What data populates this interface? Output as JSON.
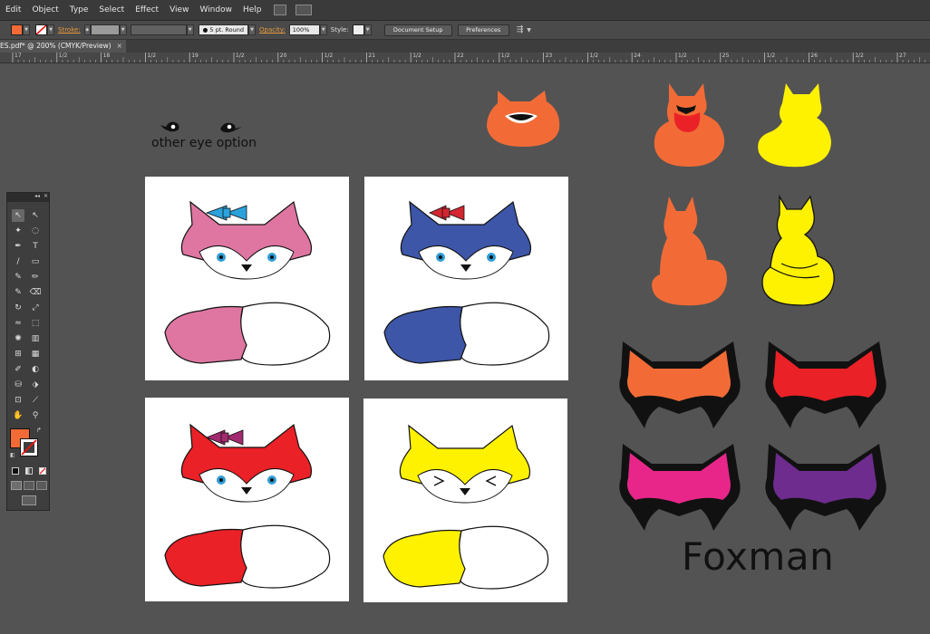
{
  "menu": [
    "Edit",
    "Object",
    "Type",
    "Select",
    "Effect",
    "View",
    "Window",
    "Help"
  ],
  "control_bar": {
    "stroke_label": "Stroke:",
    "brush": "5 pt. Round",
    "opacity_label": "Opacity:",
    "opacity_value": "100%",
    "style_label": "Style:",
    "document_setup": "Document Setup",
    "preferences": "Preferences",
    "fill_color": "#f26b36"
  },
  "document_tab": {
    "title": "ES.pdf* @ 200% (CMYK/Preview)",
    "close": "×"
  },
  "ruler": {
    "labels": [
      "17",
      "1/2",
      "18",
      "1/2",
      "19",
      "1/2",
      "20",
      "1/2",
      "21",
      "1/2",
      "22",
      "1/2",
      "23",
      "1/2",
      "24",
      "1/2",
      "25",
      "1/2",
      "26",
      "1/2",
      "27"
    ]
  },
  "canvas": {
    "eye_option_label": "other eye option",
    "foxman_label": "Foxman",
    "fox_variants": [
      {
        "fur": "#de76a1",
        "bow": "#2ba2dc"
      },
      {
        "fur": "#3d56a8",
        "bow": "#d32630"
      },
      {
        "fur": "#ea2127",
        "bow": "#a22a6e"
      },
      {
        "fur": "#fff200",
        "bow": ""
      }
    ],
    "mask_colors": [
      "#f26b36",
      "#ea2127",
      "#e8268a",
      "#6d2c8e"
    ],
    "icon_colors": {
      "orange": "#f26b36",
      "yellow": "#fff200",
      "red": "#ea2127"
    }
  },
  "toolbox": {
    "fill_color": "#f26b36",
    "tools": [
      "selection-tool",
      "direct-selection-tool",
      "magic-wand-tool",
      "lasso-tool",
      "pen-tool",
      "type-tool",
      "line-tool",
      "rectangle-tool",
      "paintbrush-tool",
      "pencil-tool",
      "blob-brush-tool",
      "eraser-tool",
      "rotate-tool",
      "scale-tool",
      "warp-tool",
      "free-transform-tool",
      "symbol-sprayer-tool",
      "column-graph-tool",
      "mesh-tool",
      "gradient-tool",
      "eyedropper-tool",
      "blend-tool",
      "live-paint-bucket-tool",
      "live-paint-selection-tool",
      "artboard-tool",
      "slice-tool",
      "hand-tool",
      "zoom-tool"
    ]
  }
}
